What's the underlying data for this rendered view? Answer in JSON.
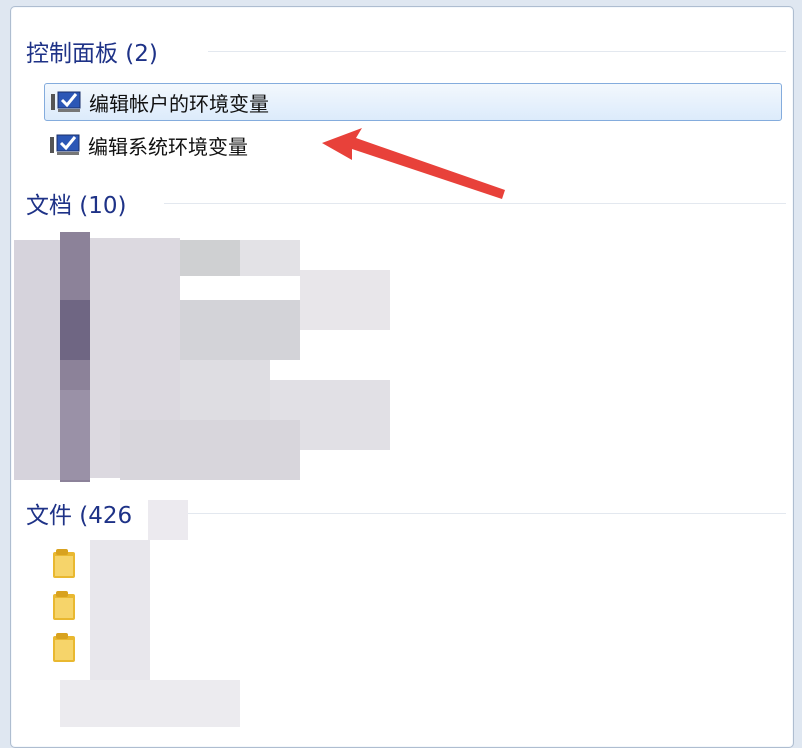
{
  "search_results": {
    "control_panel": {
      "header": "控制面板 (2)",
      "items": [
        {
          "label": "编辑帐户的环境变量",
          "selected": true,
          "icon": "control-panel-icon"
        },
        {
          "label": "编辑系统环境变量",
          "selected": false,
          "icon": "control-panel-icon"
        }
      ]
    },
    "documents": {
      "header": "文档 (10)"
    },
    "files": {
      "header": "文件 (426"
    }
  },
  "colors": {
    "header_text": "#1e3287",
    "selection_border": "#84acdd",
    "arrow": "#e8413a"
  }
}
